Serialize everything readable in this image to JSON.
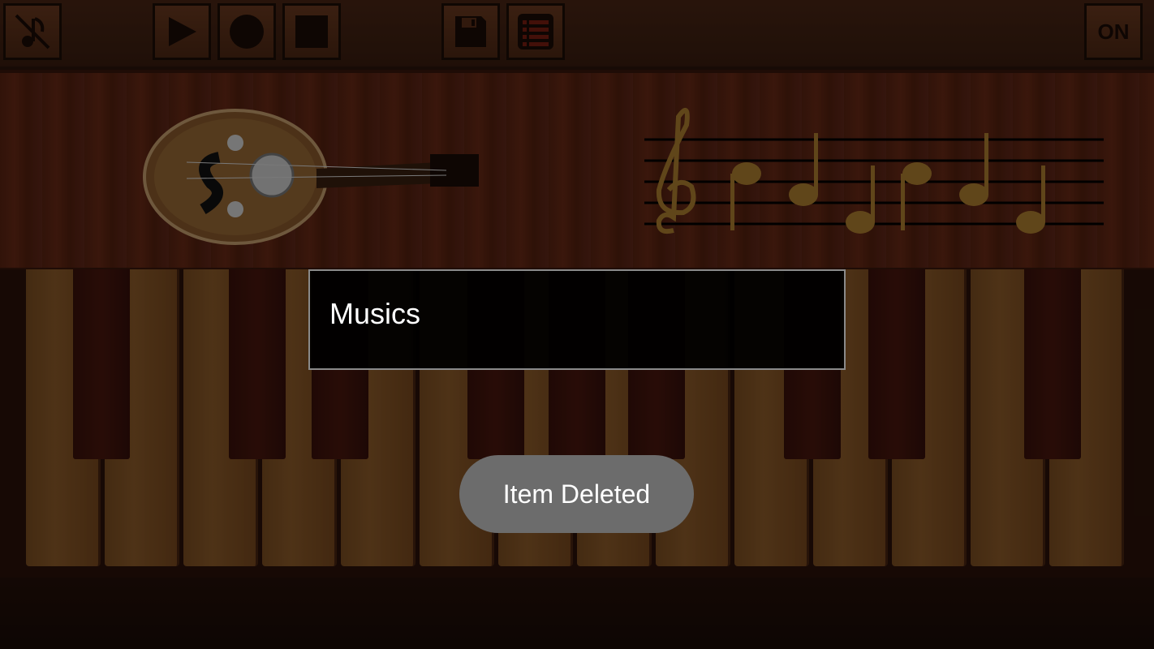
{
  "toolbar": {
    "power_label": "ON",
    "icons": [
      "music-off-icon",
      "play-icon",
      "record-icon",
      "stop-icon",
      "save-icon",
      "list-icon"
    ]
  },
  "dialog": {
    "title": "Musics"
  },
  "toast": {
    "message": "Item Deleted"
  },
  "colors": {
    "wood_dark": "#3a1d10",
    "key_white": "#8e5c2a",
    "key_black": "#3a110a",
    "note_gold": "#b08030",
    "toast_bg": "#6c6c6c"
  }
}
